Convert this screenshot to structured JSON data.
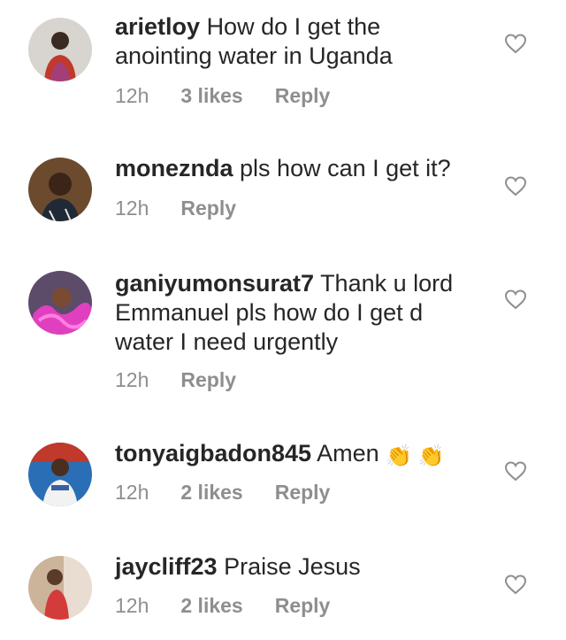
{
  "comments": [
    {
      "username": "arietloy",
      "text": "How do I get the anointing water in Uganda",
      "time": "12h",
      "likes": "3 likes",
      "reply": "Reply"
    },
    {
      "username": "moneznda",
      "text": "pls how can I get it?",
      "time": "12h",
      "likes": "",
      "reply": "Reply"
    },
    {
      "username": "ganiyumonsurat7",
      "text": "Thank u lord Emmanuel pls how do I get d water I need urgently",
      "time": "12h",
      "likes": "",
      "reply": "Reply"
    },
    {
      "username": "tonyaigbadon845",
      "text": "Amen",
      "emoji": "👏 👏",
      "time": "12h",
      "likes": "2 likes",
      "reply": "Reply"
    },
    {
      "username": "jaycliff23",
      "text": "Praise Jesus",
      "time": "12h",
      "likes": "2 likes",
      "reply": "Reply"
    }
  ],
  "icons": {
    "like": "heart-outline-icon"
  },
  "colors": {
    "text": "#262626",
    "meta": "#8e8e8e",
    "icon": "#8e8e8e"
  }
}
